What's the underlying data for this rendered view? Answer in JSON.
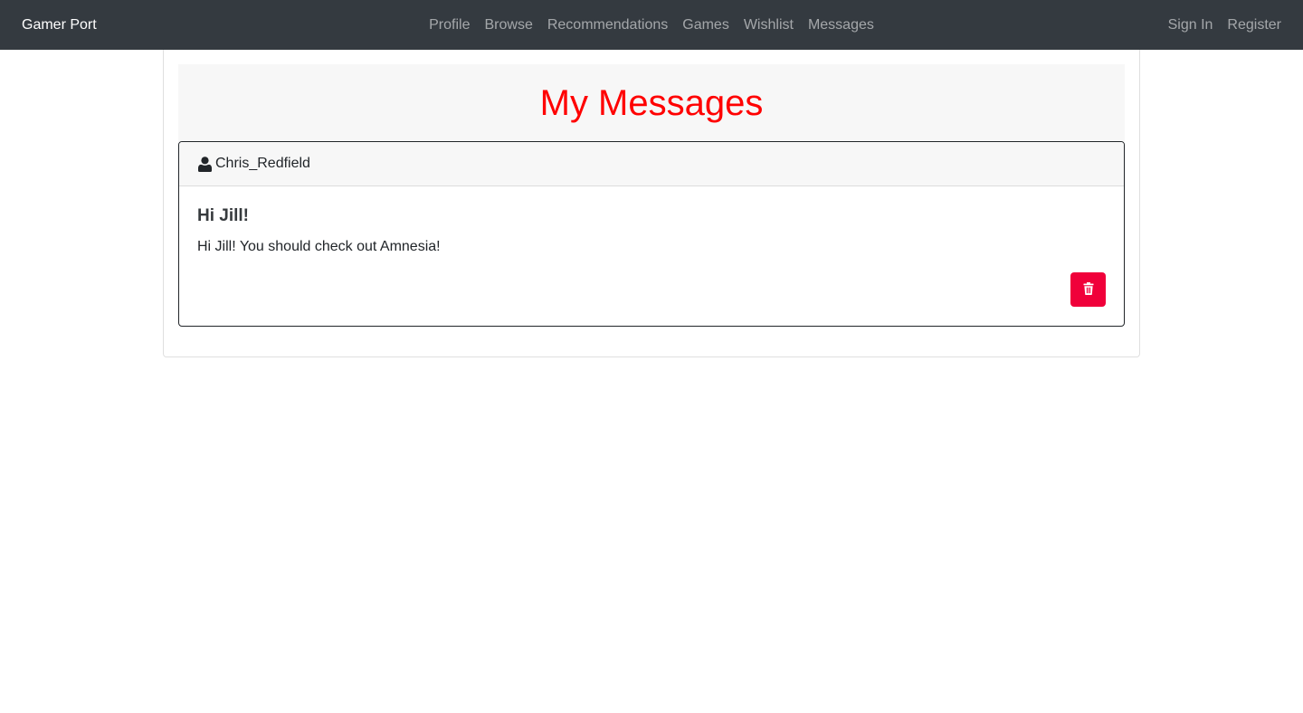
{
  "navbar": {
    "brand": "Gamer Port",
    "links": [
      "Profile",
      "Browse",
      "Recommendations",
      "Games",
      "Wishlist",
      "Messages"
    ],
    "auth": [
      "Sign In",
      "Register"
    ]
  },
  "page": {
    "title": "My Messages"
  },
  "messages": [
    {
      "sender": "Chris_Redfield",
      "sender_icon": "user-icon",
      "subject": "Hi Jill!",
      "body": "Hi Jill! You should check out Amnesia!",
      "delete_icon": "trash-icon"
    }
  ],
  "colors": {
    "navbar_bg": "#343a40",
    "title": "#ff0000",
    "delete_button": "#f0003a"
  }
}
